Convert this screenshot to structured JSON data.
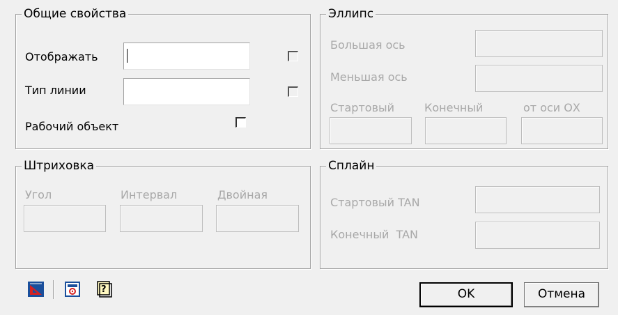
{
  "general": {
    "title": "Общие свойства",
    "display_label": "Отображать",
    "display_value": "",
    "linetype_label": "Тип линии",
    "linetype_value": "",
    "working_object_label": "Рабочий объект"
  },
  "hatch": {
    "title": "Штриховка",
    "angle_label": "Угол",
    "interval_label": "Интервал",
    "double_label": "Двойная"
  },
  "ellipse": {
    "title": "Эллипс",
    "major_axis_label": "Большая ось",
    "minor_axis_label": "Меньшая ось",
    "start_label": "Стартовый",
    "end_label": "Конечный",
    "ox_label": "от оси ОХ"
  },
  "spline": {
    "title": "Сплайн",
    "start_tan_label": "Стартовый TAN",
    "end_tan_label": "Конечный  TAN"
  },
  "buttons": {
    "ok": "OK",
    "cancel": "Отмена"
  },
  "icons": [
    "drawing-icon",
    "calculator-icon",
    "help-icon"
  ]
}
